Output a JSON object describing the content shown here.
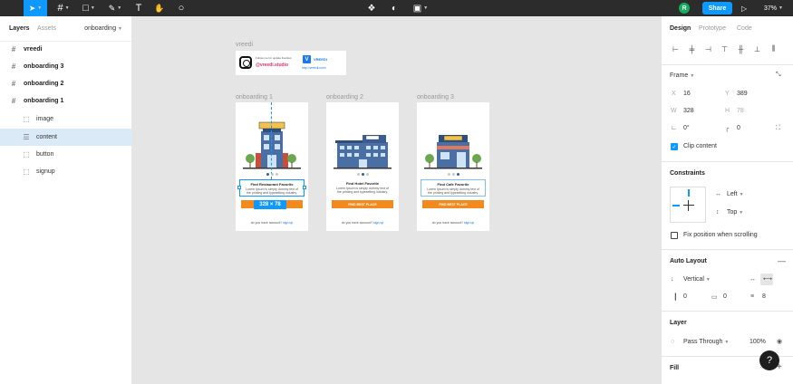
{
  "toolbar": {
    "tools": [
      {
        "icon": "move-icon",
        "glyph": "➤"
      },
      {
        "icon": "frame-icon",
        "glyph": "#"
      },
      {
        "icon": "rectangle-icon",
        "glyph": "□"
      },
      {
        "icon": "pen-icon",
        "glyph": "✎"
      },
      {
        "icon": "text-icon",
        "glyph": "T"
      },
      {
        "icon": "hand-icon",
        "glyph": "✋"
      },
      {
        "icon": "comment-icon",
        "glyph": "○"
      }
    ],
    "center_icons": [
      "components-icon",
      "contrast-icon",
      "boolean-icon"
    ],
    "avatar_initial": "R",
    "share_label": "Share",
    "zoom": "37%"
  },
  "left_panel": {
    "tabs": [
      "Layers",
      "Assets"
    ],
    "page": "onboarding",
    "layers": [
      {
        "name": "vreedi",
        "kind": "frame"
      },
      {
        "name": "onboarding 3",
        "kind": "frame"
      },
      {
        "name": "onboarding 2",
        "kind": "frame"
      },
      {
        "name": "onboarding 1",
        "kind": "frame"
      },
      {
        "name": "image",
        "kind": "child"
      },
      {
        "name": "content",
        "kind": "child-selected"
      },
      {
        "name": "button",
        "kind": "child"
      },
      {
        "name": "signup",
        "kind": "child"
      }
    ]
  },
  "canvas": {
    "banner_label": "vreedi",
    "banner": {
      "follow_text": "Follow me for update freebies",
      "handle": "@vreedi.studio",
      "brand": "VREEDI",
      "brand_initial": "V",
      "url": "http://vreedi.com/"
    },
    "frames": [
      {
        "label": "onboarding 1",
        "title": "Find Restaurant Favorite",
        "sign": "RESTAURANT"
      },
      {
        "label": "onboarding 2",
        "title": "Find Hotel Favorite",
        "sign": "HOTEL"
      },
      {
        "label": "onboarding 3",
        "title": "Find Cafe Favorite",
        "sign": "CAFE"
      }
    ],
    "description_line1": "Lorem Ipsum is simply dummy text of",
    "description_line2": "the printing and typesetting industry.",
    "cta_label": "FIND BEST PLACE",
    "signup_text": "do you have account?",
    "signup_link": "sign up",
    "size_badge": "328 × 78"
  },
  "right_panel": {
    "tabs": [
      "Design",
      "Prototype",
      "Code"
    ],
    "frame_label": "Frame",
    "x_label": "X",
    "x": "16",
    "y_label": "Y",
    "y": "389",
    "w_label": "W",
    "w": "328",
    "h_label": "H",
    "h": "78",
    "rotation": "0°",
    "radius": "0",
    "clip_content": "Clip content",
    "constraints_title": "Constraints",
    "constraint_h": "Left",
    "constraint_v": "Top",
    "fix_position": "Fix position when scrolling",
    "autolayout_title": "Auto Layout",
    "direction": "Vertical",
    "padding_h": "0",
    "padding_v": "0",
    "spacing": "8",
    "layer_title": "Layer",
    "blend": "Pass Through",
    "opacity": "100%",
    "fill_title": "Fill"
  }
}
